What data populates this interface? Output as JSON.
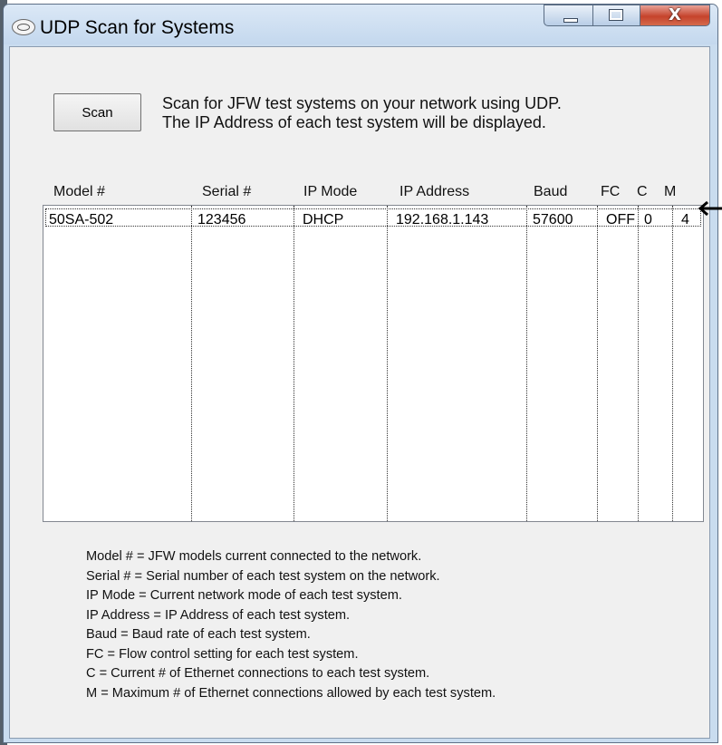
{
  "window": {
    "title": "UDP Scan for Systems",
    "close_glyph": "X"
  },
  "scan_button": {
    "label": "Scan"
  },
  "description": {
    "line1": "Scan for JFW test systems on your network using UDP.",
    "line2": "The IP Address of each test system will be displayed."
  },
  "table": {
    "columns": [
      "Model #",
      "Serial #",
      "IP Mode",
      "IP Address",
      "Baud",
      "FC",
      "C",
      "M"
    ],
    "rows": [
      [
        "50SA-502",
        "123456",
        "DHCP",
        "192.168.1.143",
        "57600",
        "OFF",
        "0",
        "4"
      ]
    ]
  },
  "indicator": {
    "arrow_icon": "left-arrow-icon"
  },
  "legend": [
    "Model # = JFW models current connected to the network.",
    "Serial # = Serial number of each test system on the network.",
    "IP Mode = Current network mode of each test system.",
    "IP Address = IP Address of each test system.",
    "Baud = Baud rate of each test system.",
    "FC = Flow control setting for each test system.",
    "C = Current # of Ethernet connections to each test system.",
    "M = Maximum # of Ethernet connections allowed by each test system."
  ],
  "colors": {
    "title_bar": "#c4d8ee",
    "close_button": "#c5432c",
    "client_background": "#f0f0f0"
  }
}
